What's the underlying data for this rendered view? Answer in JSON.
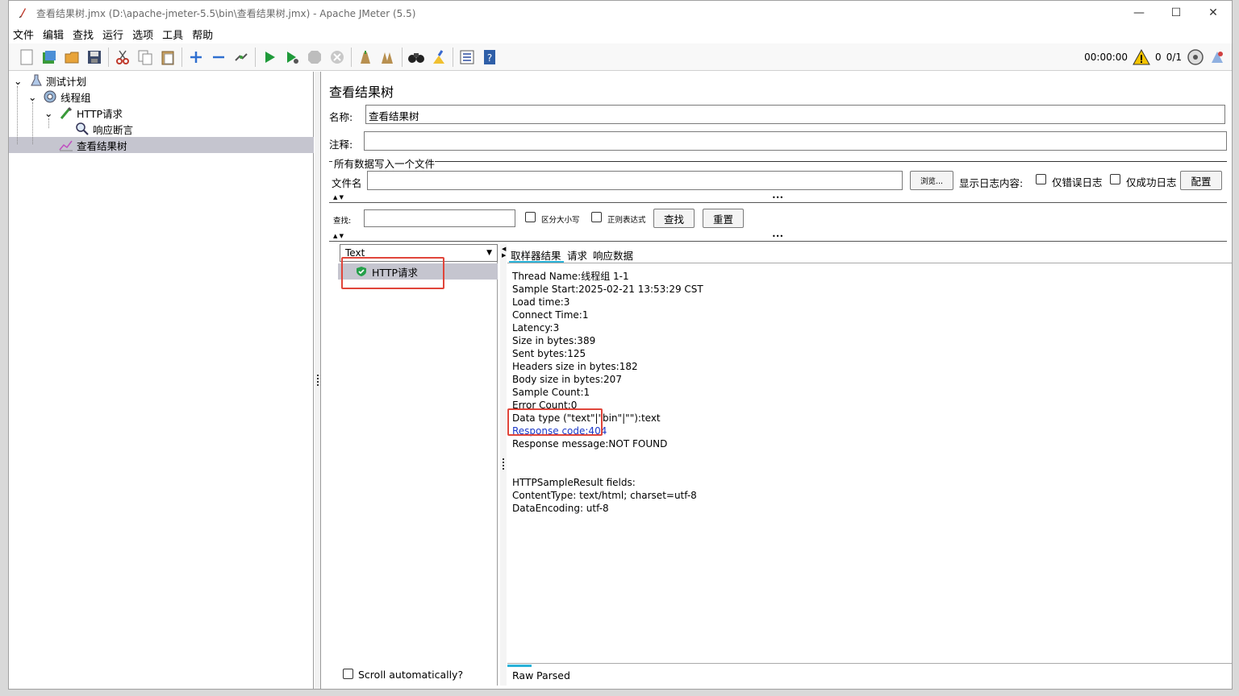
{
  "window": {
    "title": "查看结果树.jmx (D:\\apache-jmeter-5.5\\bin\\查看结果树.jmx) - Apache JMeter (5.5)",
    "controls": {
      "minimize": "—",
      "maximize": "☐",
      "close": "✕"
    }
  },
  "menu": [
    "文件",
    "编辑",
    "查找",
    "运行",
    "选项",
    "工具",
    "帮助"
  ],
  "toolbar": {
    "timer": "00:00:00",
    "warnings": "0",
    "threads": "0/1"
  },
  "tree": {
    "items": [
      {
        "label": "测试计划",
        "icon": "flask-icon"
      },
      {
        "label": "线程组",
        "icon": "gear-icon"
      },
      {
        "label": "HTTP请求",
        "icon": "pipette-icon"
      },
      {
        "label": "响应断言",
        "icon": "magnifier-icon"
      },
      {
        "label": "查看结果树",
        "icon": "chart-icon"
      }
    ]
  },
  "panel": {
    "heading": "查看结果树",
    "name_label": "名称:",
    "name_value": "查看结果树",
    "comment_label": "注释:",
    "comment_value": "",
    "file_section": "所有数据写入一个文件",
    "filename_label": "文件名",
    "filename_value": "",
    "browse": "浏览...",
    "log_label": "显示日志内容:",
    "errors_only": "仅错误日志",
    "success_only": "仅成功日志",
    "configure": "配置",
    "search_label": "查找:",
    "search_value": "",
    "case_sensitive": "区分大小写",
    "regex": "正则表达式",
    "find_button": "查找",
    "reset_button": "重置"
  },
  "results": {
    "renderer": "Text",
    "samples": [
      {
        "label": "HTTP请求",
        "status": "success"
      }
    ],
    "scroll_auto": "Scroll automatically?"
  },
  "detail": {
    "tabs": [
      "取样器结果",
      "请求",
      "响应数据"
    ],
    "lines": [
      "Thread Name:线程组 1-1",
      "Sample Start:2025-02-21 13:53:29 CST",
      "Load time:3",
      "Connect Time:1",
      "Latency:3",
      "Size in bytes:389",
      "Sent bytes:125",
      "Headers size in bytes:182",
      "Body size in bytes:207",
      "Sample Count:1",
      "Error Count:0",
      "Data type (\"text\"|\"bin\"|\"\"):text",
      "Response code:404",
      "Response message:NOT FOUND",
      "",
      "",
      "HTTPSampleResult fields:",
      "ContentType: text/html; charset=utf-8",
      "DataEncoding: utf-8"
    ],
    "highlight_color": "#1c39c8",
    "bottom_tabs": [
      "Raw",
      "Parsed"
    ]
  }
}
